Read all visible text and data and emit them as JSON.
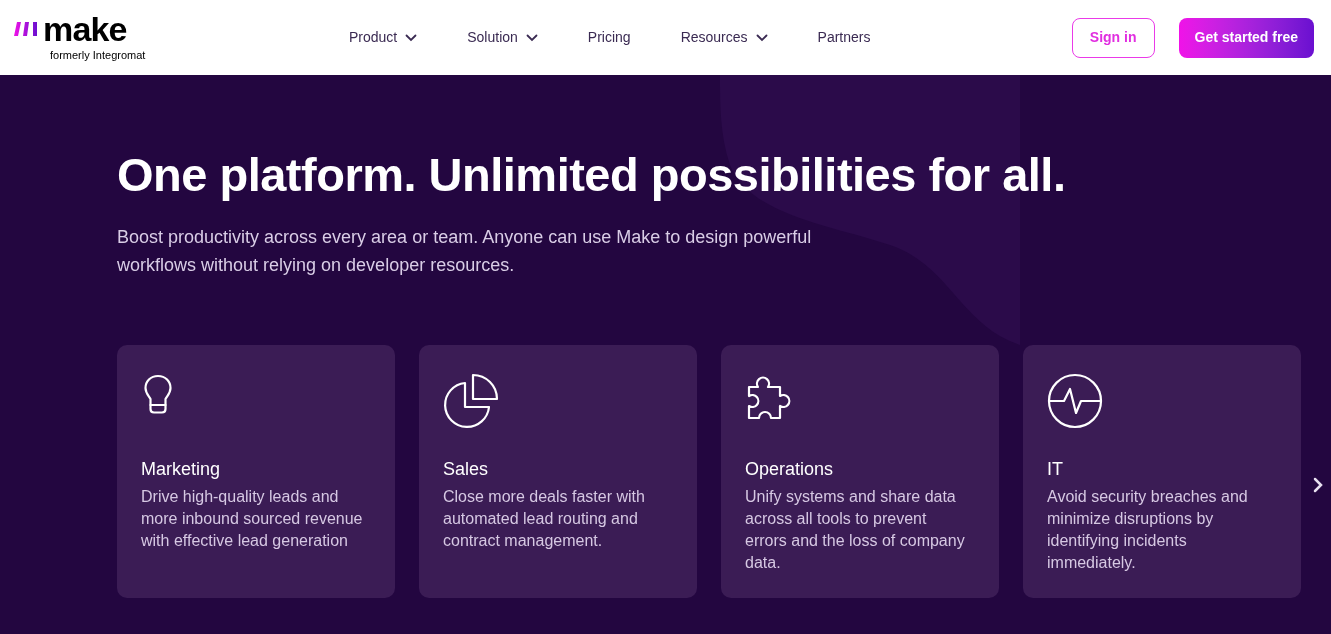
{
  "header": {
    "logo": {
      "wordmark": "make",
      "tagline": "formerly Integromat"
    },
    "nav": [
      {
        "label": "Product",
        "has_menu": true
      },
      {
        "label": "Solution",
        "has_menu": true
      },
      {
        "label": "Pricing",
        "has_menu": false
      },
      {
        "label": "Resources",
        "has_menu": true
      },
      {
        "label": "Partners",
        "has_menu": false
      }
    ],
    "sign_in": "Sign in",
    "cta": "Get started free"
  },
  "hero": {
    "title": "One platform. Unlimited possibilities for all.",
    "subtitle": "Boost productivity across every area or team. Anyone can use Make to design powerful workflows without relying on developer resources."
  },
  "cards": [
    {
      "kind": "bulb",
      "title": "Marketing",
      "text": "Drive high-quality leads and more inbound sourced revenue with effective lead generation"
    },
    {
      "kind": "pie",
      "title": "Sales",
      "text": "Close more deals faster with automated lead routing and contract management."
    },
    {
      "kind": "puzzle",
      "title": "Operations",
      "text": "Unify systems and share data across all tools to prevent errors and the loss of company data."
    },
    {
      "kind": "pulse",
      "title": "IT",
      "text": "Avoid security breaches and minimize disruptions by identifying incidents immediately."
    }
  ]
}
